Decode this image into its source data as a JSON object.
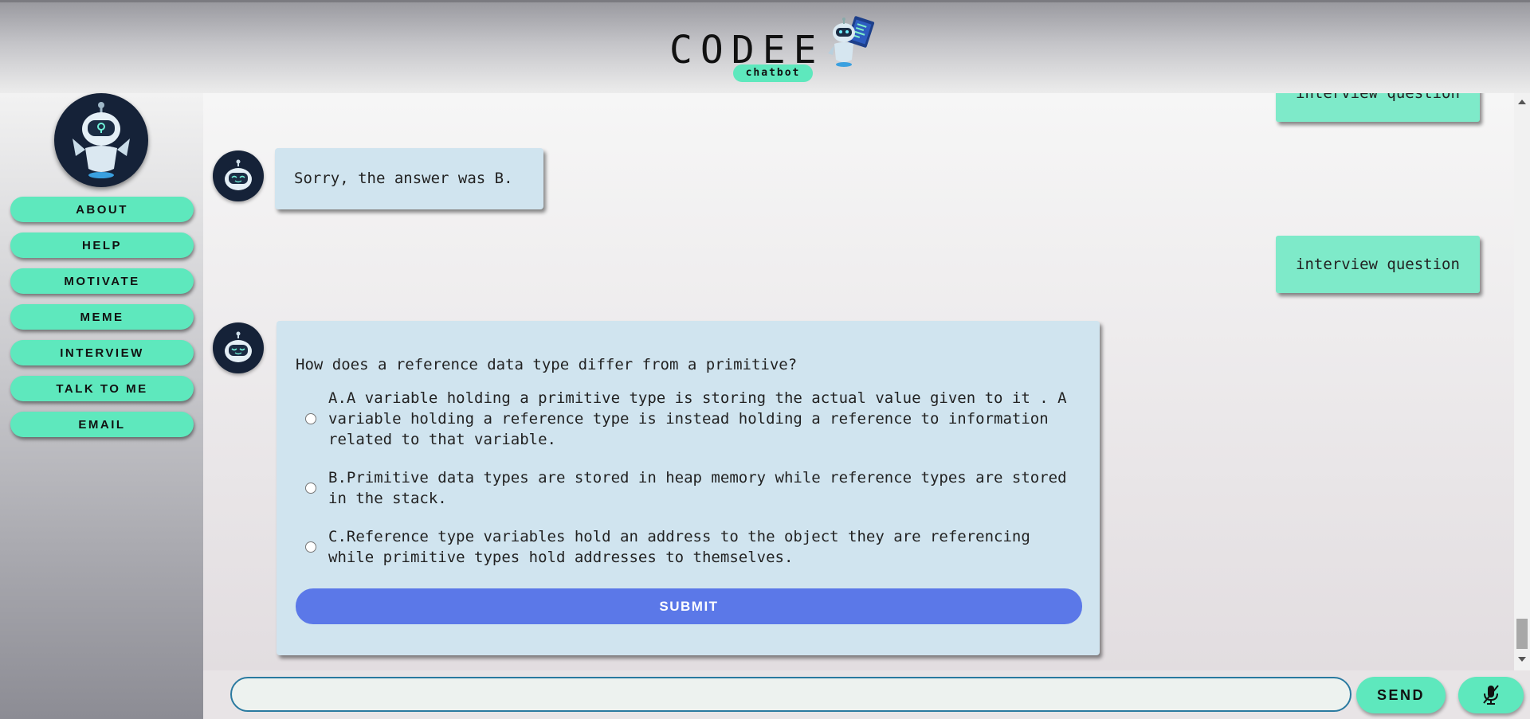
{
  "header": {
    "title": "CODEE",
    "subtitle": "chatbot"
  },
  "sidebar": {
    "items": [
      {
        "label": "ABOUT"
      },
      {
        "label": "HELP"
      },
      {
        "label": "MOTIVATE"
      },
      {
        "label": "MEME"
      },
      {
        "label": "INTERVIEW"
      },
      {
        "label": "TALK TO ME"
      },
      {
        "label": "EMAIL"
      }
    ]
  },
  "messages": {
    "user_top": "interview question",
    "bot_reply": "Sorry, the answer was B.",
    "user_second": "interview question"
  },
  "quiz": {
    "question": "How does a reference data type differ from a primitive?",
    "options": [
      {
        "text": "A.A variable holding a primitive type is storing the actual value given to it . A variable holding a reference type is instead holding a reference to information related to that variable."
      },
      {
        "text": "B.Primitive data types are stored in heap memory while reference types are stored in the stack."
      },
      {
        "text": "C.Reference type variables hold an address to the object they are referencing while primitive types hold addresses to themselves."
      }
    ],
    "submit_label": "SUBMIT"
  },
  "composer": {
    "input_value": "",
    "placeholder": "",
    "send_label": "SEND",
    "mic_icon": "microphone-muted-icon"
  },
  "colors": {
    "accent_mint": "#5ee8bd",
    "user_bubble": "#7eeac9",
    "bot_bubble": "#d0e4ef",
    "submit_blue": "#5b78e8",
    "avatar_navy": "#152238"
  }
}
